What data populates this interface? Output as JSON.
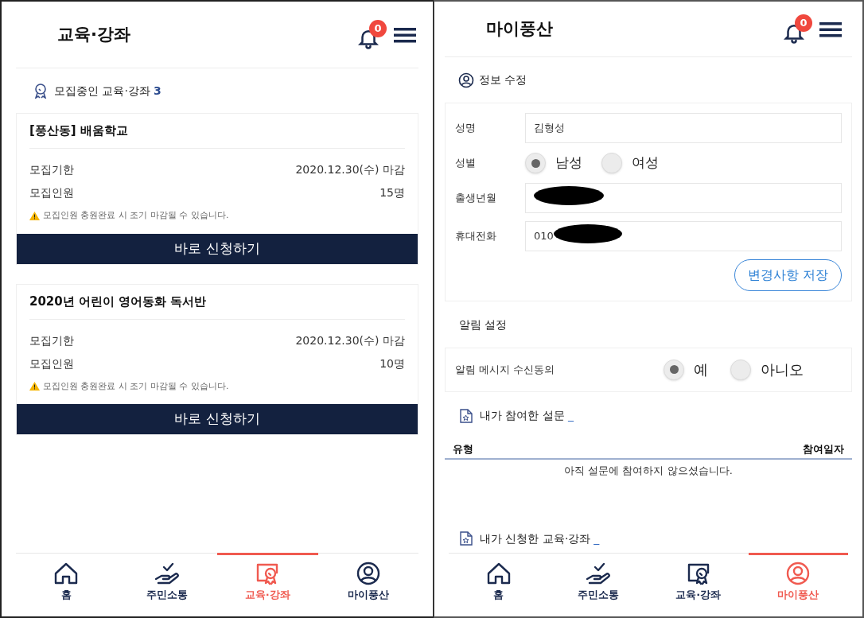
{
  "left_screen": {
    "title": "교육·강좌",
    "notification_count": "0",
    "subtitle": {
      "label": "모집중인 교육·강좌",
      "count": "3"
    },
    "courses": [
      {
        "title": "[풍산동] 배움학교",
        "rows": [
          {
            "label": "모집기한",
            "value": "2020.12.30(수) 마감"
          },
          {
            "label": "모집인원",
            "value": "15명"
          }
        ],
        "notice": "모집인원 충원완료 시 조기 마감될 수 있습니다.",
        "button": "바로 신청하기"
      },
      {
        "title": "2020년 어린이 영어동화 독서반",
        "rows": [
          {
            "label": "모집기한",
            "value": "2020.12.30(수) 마감"
          },
          {
            "label": "모집인원",
            "value": "10명"
          }
        ],
        "notice": "모집인원 충원완료 시 조기 마감될 수 있습니다.",
        "button": "바로 신청하기"
      }
    ],
    "nav": [
      {
        "kind": "home",
        "label": "홈",
        "selected": false
      },
      {
        "kind": "community",
        "label": "주민소통",
        "selected": false
      },
      {
        "kind": "education",
        "label": "교육·강좌",
        "selected": true
      },
      {
        "kind": "mypage",
        "label": "마이풍산",
        "selected": false
      }
    ]
  },
  "right_screen": {
    "title": "마이풍산",
    "notification_count": "0",
    "profile_section": {
      "title": "정보 수정",
      "fields": [
        {
          "kind": "text",
          "label": "성명",
          "value": "김형성"
        },
        {
          "kind": "radio",
          "label": "성별",
          "options": [
            {
              "label": "남성",
              "selected": true
            },
            {
              "label": "여성",
              "selected": false
            }
          ]
        },
        {
          "kind": "text",
          "label": "출생년월",
          "redacted": true
        },
        {
          "kind": "text",
          "label": "휴대전화",
          "value": "010",
          "redacted": true
        }
      ],
      "save_button": "변경사항 저장"
    },
    "notification_section": {
      "title": "알림 설정",
      "label": "알림 메시지 수신동의",
      "options": [
        {
          "label": "예",
          "selected": true
        },
        {
          "label": "아니오",
          "selected": false
        }
      ]
    },
    "survey_section": {
      "title": "내가 참여한 설문",
      "suffix": "_",
      "columns": [
        "유형",
        "참여일자"
      ],
      "empty_message": "아직 설문에 참여하지 않으셨습니다."
    },
    "course_section": {
      "title": "내가 신청한 교육·강좌",
      "suffix": "_"
    },
    "nav": [
      {
        "kind": "home",
        "label": "홈",
        "selected": false
      },
      {
        "kind": "community",
        "label": "주민소통",
        "selected": false
      },
      {
        "kind": "education",
        "label": "교육·강좌",
        "selected": false
      },
      {
        "kind": "mypage",
        "label": "마이풍산",
        "selected": true
      }
    ]
  }
}
